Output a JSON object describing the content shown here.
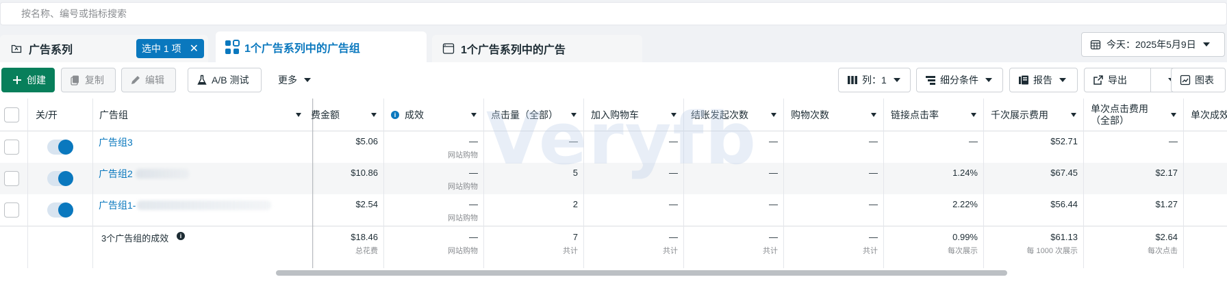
{
  "search": {
    "placeholder": "按名称、编号或指标搜索"
  },
  "tabs": [
    {
      "label": "广告系列",
      "icon": "folder-icon"
    },
    {
      "label": "1个广告系列中的广告组",
      "icon": "grid-icon"
    },
    {
      "label": "1个广告系列中的广告",
      "icon": "ad-icon"
    }
  ],
  "selection": {
    "label": "选中 1 项",
    "close": "✕"
  },
  "date": {
    "label": "今天：2025年5月9日"
  },
  "toolbar": {
    "create": "创建",
    "copy": "复制",
    "edit": "编辑",
    "ab_test": "A/B 测试",
    "more": "更多",
    "columns": "列：1",
    "breakdown": "细分条件",
    "report": "报告",
    "export": "导出",
    "chart": "图表"
  },
  "table": {
    "headers": {
      "toggle": "关/开",
      "name": "广告组",
      "spend": "费金额",
      "results": "成效",
      "clicks": "点击量（全部）",
      "add_to_cart": "加入购物车",
      "checkout": "结账发起次数",
      "purchases": "购物次数",
      "ctr": "链接点击率",
      "cpm": "千次展示费用",
      "cpc_line1": "单次点击费用",
      "cpc_line2": "（全部）",
      "cpr": "单次成效"
    },
    "rows": [
      {
        "name": "广告组3",
        "spend": "$5.06",
        "results": "—",
        "results_sub": "网站购物",
        "clicks": "—",
        "add_to_cart": "—",
        "checkout": "—",
        "purchases": "—",
        "ctr": "—",
        "cpm": "$52.71",
        "cpc": "—",
        "active": true
      },
      {
        "name": "广告组2",
        "spend": "$10.86",
        "results": "—",
        "results_sub": "网站购物",
        "clicks": "5",
        "add_to_cart": "—",
        "checkout": "—",
        "purchases": "—",
        "ctr": "1.24%",
        "cpm": "$67.45",
        "cpc": "$2.17",
        "active": true
      },
      {
        "name": "广告组1-",
        "spend": "$2.54",
        "results": "—",
        "results_sub": "网站购物",
        "clicks": "2",
        "add_to_cart": "—",
        "checkout": "—",
        "purchases": "—",
        "ctr": "2.22%",
        "cpm": "$56.44",
        "cpc": "$1.27",
        "active": true
      }
    ],
    "summary": {
      "label": "3个广告组的成效",
      "spend": "$18.46",
      "spend_sub": "总花费",
      "results": "—",
      "results_sub": "网站购物",
      "clicks": "7",
      "clicks_sub": "共计",
      "add_to_cart": "—",
      "add_to_cart_sub": "共计",
      "checkout": "—",
      "checkout_sub": "共计",
      "purchases": "—",
      "purchases_sub": "共计",
      "ctr": "0.99%",
      "ctr_sub": "每次展示",
      "cpm": "$61.13",
      "cpm_sub": "每 1000 次展示",
      "cpc": "$2.64",
      "cpc_sub": "每次点击"
    }
  },
  "watermark": "Veryfb",
  "colors": {
    "accent": "#0a78be",
    "create": "#087f5b",
    "border": "#dadde1"
  }
}
